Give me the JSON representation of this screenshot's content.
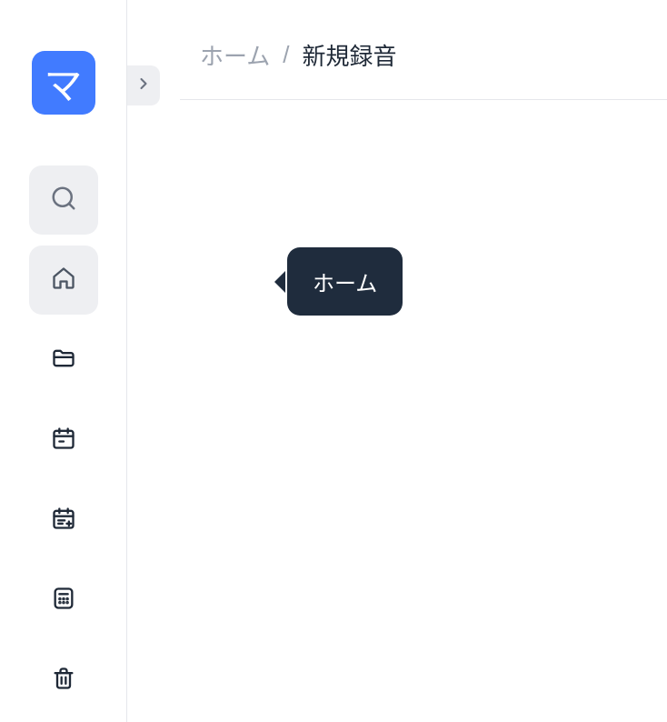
{
  "logo": {
    "label": "マ"
  },
  "sidebar": {
    "items": [
      {
        "name": "search"
      },
      {
        "name": "home"
      },
      {
        "name": "folder"
      },
      {
        "name": "calendar"
      },
      {
        "name": "schedule-add"
      },
      {
        "name": "calculator"
      },
      {
        "name": "trash"
      }
    ]
  },
  "breadcrumb": {
    "home": "ホーム",
    "separator": "/",
    "current": "新規録音"
  },
  "tooltip": {
    "home": "ホーム"
  }
}
